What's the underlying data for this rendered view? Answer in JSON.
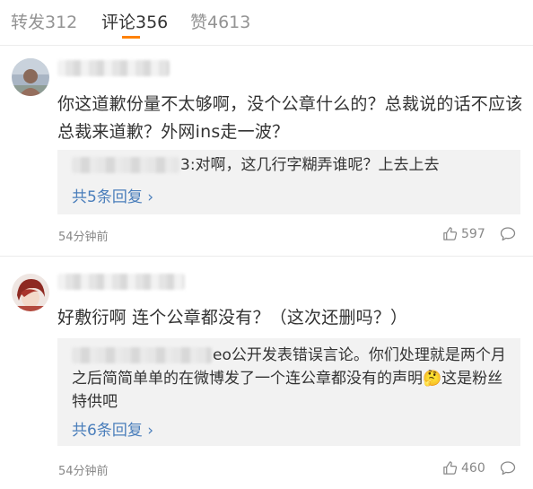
{
  "tabs": [
    {
      "label": "转发312",
      "active": false
    },
    {
      "label": "评论356",
      "active": true
    },
    {
      "label": "赞4613",
      "active": false
    }
  ],
  "colors": {
    "accent": "#ff8200",
    "link": "#4a7ebb",
    "muted": "#888888",
    "text": "#333333",
    "reply_bg": "#f2f2f2"
  },
  "comments": [
    {
      "avatar_icon": "user-avatar-icon",
      "text": "你这道歉份量不太够啊，没个公章什么的？总裁说的话不应该总裁来道歉？外网ins走一波？",
      "reply_preview": "3:对啊，这几行字糊弄谁呢？上去上去",
      "reply_more": "共5条回复",
      "time": "54分钟前",
      "likes": "597"
    },
    {
      "avatar_icon": "user-avatar-icon",
      "text": "好敷衍啊 连个公章都没有？（这次还删吗？）",
      "reply_preview": "eo公开发表错误言论。你们处理就是两个月之后简简单单的在微博发了一个连公章都没有的声明🤔这是粉丝特供吧",
      "reply_more": "共6条回复",
      "time": "54分钟前",
      "likes": "460"
    }
  ]
}
